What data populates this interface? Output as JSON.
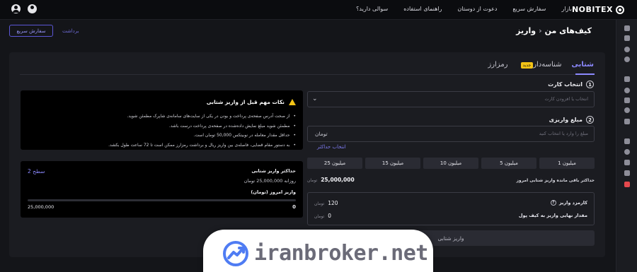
{
  "brand": {
    "name": "NOBITEX"
  },
  "nav": {
    "items": [
      "بازار",
      "سفارش سریع",
      "دعوت از دوستان",
      "راهنمای استفاده",
      "سوالی دارید؟"
    ]
  },
  "breadcrumb": {
    "root": "کیف‌های من",
    "sep": "›",
    "current": "واریز"
  },
  "actions": {
    "quick_order": "سفارش سریع",
    "withdraw": "برداشت"
  },
  "tabs": [
    {
      "label": "شتابی"
    },
    {
      "label": "شناسه‌دار",
      "badge": "جدید"
    },
    {
      "label": "رمزارز"
    }
  ],
  "form": {
    "card": {
      "step": "1",
      "label": "انتخاب کارت",
      "placeholder": "انتخاب یا افزودن کارت"
    },
    "amount": {
      "step": "2",
      "label": "مبلغ واریزی",
      "placeholder": "مبلغ را وارد یا انتخاب کنید",
      "unit": "تومان"
    },
    "max_link": "انتخاب حداکثر",
    "chips": [
      "1 میلیون",
      "5 میلیون",
      "10 میلیون",
      "15 میلیون",
      "25 میلیون"
    ],
    "max_remaining": {
      "label": "حداکثر باقی مانده واریز شتابی امروز",
      "value": "25,000,000",
      "unit": "تومان"
    },
    "fee": {
      "label": "کارمزد واریز",
      "info": "?",
      "value": "120",
      "unit": "تومان"
    },
    "final": {
      "label": "مقدار نهایی واریز به کیف پول",
      "value": "0",
      "unit": "تومان"
    },
    "submit": "واریز شتابی"
  },
  "notes": {
    "title": "نکات مهم قبل از واریز شتابی",
    "items": [
      "از صحت آدرس صفحه‌ی پرداخت و بودن در یکی از سایت‌های سامانه‌ی شاپرک مطمئن شوید.",
      "مطمئن شوید مبلغ نمایش داده‌شده در صفحه‌ی پرداخت درست باشد.",
      "حداقل مقدار معامله در نوبیتکس 50,000 تومان است.",
      "به دستور مقام قضایی، فاصله‌ی بین واریز ریال و برداشت رمزارز ممکن است تا 72 ساعت طول بکشد."
    ]
  },
  "limits": {
    "title": "حداکثر واریز شتابی",
    "daily": "روزانه 25,000,000 تومان",
    "level": "سطح 2",
    "today_label": "واریز امروز (تومان)",
    "progress_fraction": 0,
    "min": "0",
    "max": "25,000,000"
  },
  "watermark": {
    "text": "iranbroker.net"
  },
  "colors": {
    "accent": "#8c89ff",
    "badge": "#f3c316",
    "danger": "#e5484d"
  }
}
